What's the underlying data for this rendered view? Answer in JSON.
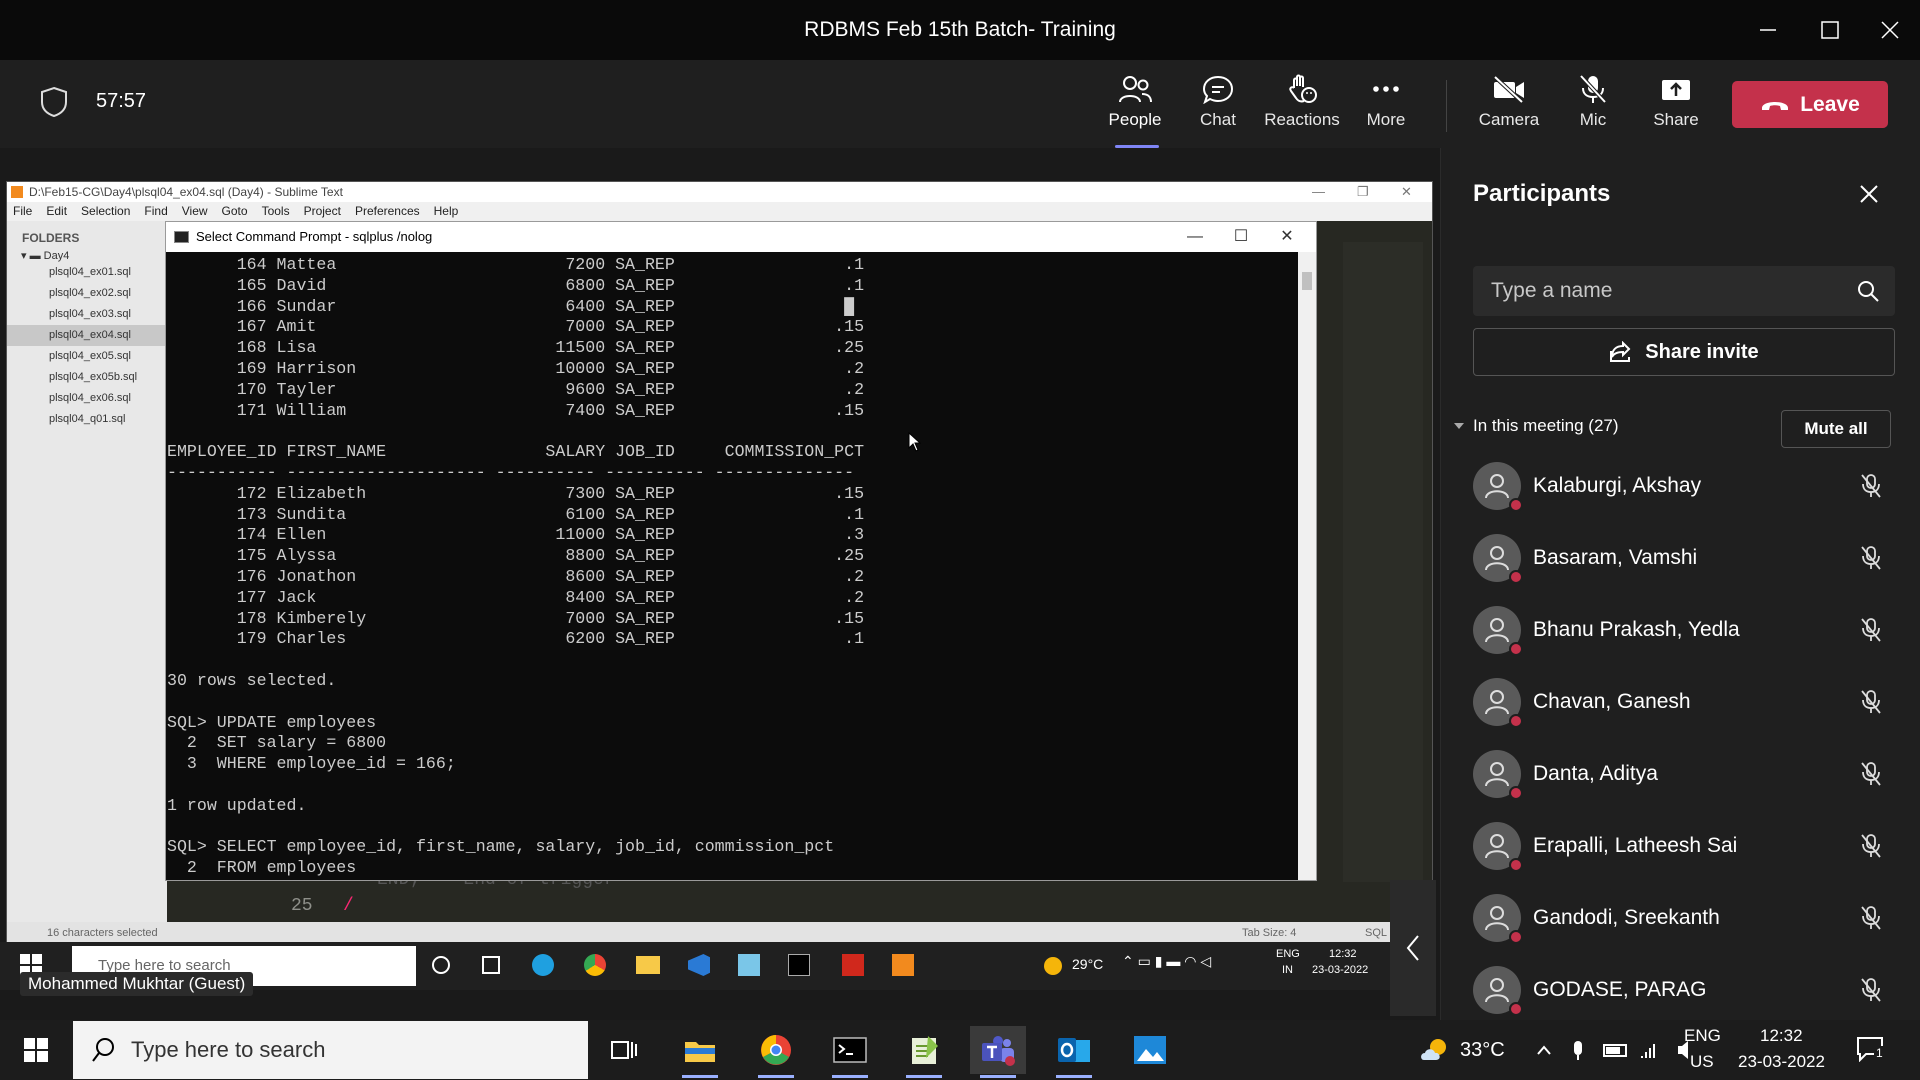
{
  "window": {
    "title": "RDBMS Feb 15th Batch- Training"
  },
  "meeting": {
    "timer": "57:57",
    "buttons": {
      "people": "People",
      "chat": "Chat",
      "reactions": "Reactions",
      "more": "More",
      "camera": "Camera",
      "mic": "Mic",
      "share": "Share"
    },
    "leave": "Leave"
  },
  "sublime": {
    "title": "D:\\Feb15-CG\\Day4\\plsql04_ex04.sql (Day4) - Sublime Text",
    "menu": [
      "File",
      "Edit",
      "Selection",
      "Find",
      "View",
      "Goto",
      "Tools",
      "Project",
      "Preferences",
      "Help"
    ],
    "folders_label": "FOLDERS",
    "folder": "Day4",
    "files": [
      "plsql04_ex01.sql",
      "plsql04_ex02.sql",
      "plsql04_ex03.sql",
      "plsql04_ex04.sql",
      "plsql04_ex05.sql",
      "plsql04_ex05b.sql",
      "plsql04_ex06.sql",
      "plsql04_q01.sql"
    ],
    "selected_file_index": 3,
    "status_left": "16 characters selected",
    "status_tab": "Tab Size: 4",
    "status_syntax": "SQL",
    "code_line_no": "25",
    "code_line": "/",
    "code_faded": "END;  -- End of trigger"
  },
  "cmd": {
    "title": "Select Command Prompt - sqlplus /nolog",
    "lines": [
      "       164 Mattea                       7200 SA_REP                 .1",
      "       165 David                        6800 SA_REP                 .1",
      "       166 Sundar                       6400 SA_REP                 █",
      "       167 Amit                         7000 SA_REP                .15",
      "       168 Lisa                        11500 SA_REP                .25",
      "       169 Harrison                    10000 SA_REP                 .2",
      "       170 Tayler                       9600 SA_REP                 .2",
      "       171 William                      7400 SA_REP                .15",
      "",
      "EMPLOYEE_ID FIRST_NAME                SALARY JOB_ID     COMMISSION_PCT",
      "----------- -------------------- ---------- ---------- --------------",
      "       172 Elizabeth                    7300 SA_REP                .15",
      "       173 Sundita                      6100 SA_REP                 .1",
      "       174 Ellen                       11000 SA_REP                 .3",
      "       175 Alyssa                       8800 SA_REP                .25",
      "       176 Jonathon                     8600 SA_REP                 .2",
      "       177 Jack                         8400 SA_REP                 .2",
      "       178 Kimberely                    7000 SA_REP                .15",
      "       179 Charles                      6200 SA_REP                 .1",
      "",
      "30 rows selected.",
      "",
      "SQL> UPDATE employees",
      "  2  SET salary = 6800",
      "  3  WHERE employee_id = 166;",
      "",
      "1 row updated.",
      "",
      "SQL> SELECT employee_id, first_name, salary, job_id, commission_pct",
      "  2  FROM employees"
    ]
  },
  "inner_taskbar": {
    "search": "Type here to search",
    "weather": "29°C",
    "lang1": "ENG",
    "lang2": "IN",
    "time": "12:32",
    "date": "23-03-2022"
  },
  "guest_label": "Mohammed Mukhtar (Guest)",
  "participants": {
    "title": "Participants",
    "search_placeholder": "Type a name",
    "share_invite": "Share invite",
    "section": "In this meeting (27)",
    "mute_all": "Mute all",
    "people": [
      "Kalaburgi, Akshay",
      "Basaram, Vamshi",
      "Bhanu Prakash, Yedla",
      "Chavan, Ganesh",
      "Danta, Aditya",
      "Erapalli, Latheesh Sai",
      "Gandodi, Sreekanth",
      "GODASE, PARAG"
    ]
  },
  "taskbar": {
    "search": "Type here to search",
    "weather": "33°C",
    "lang1": "ENG",
    "lang2": "US",
    "time": "12:32",
    "date": "23-03-2022",
    "notifications": "1"
  },
  "colors": {
    "leave": "#c4314b",
    "active_underline": "#7f85f5",
    "status_dot": "#c4314b"
  }
}
